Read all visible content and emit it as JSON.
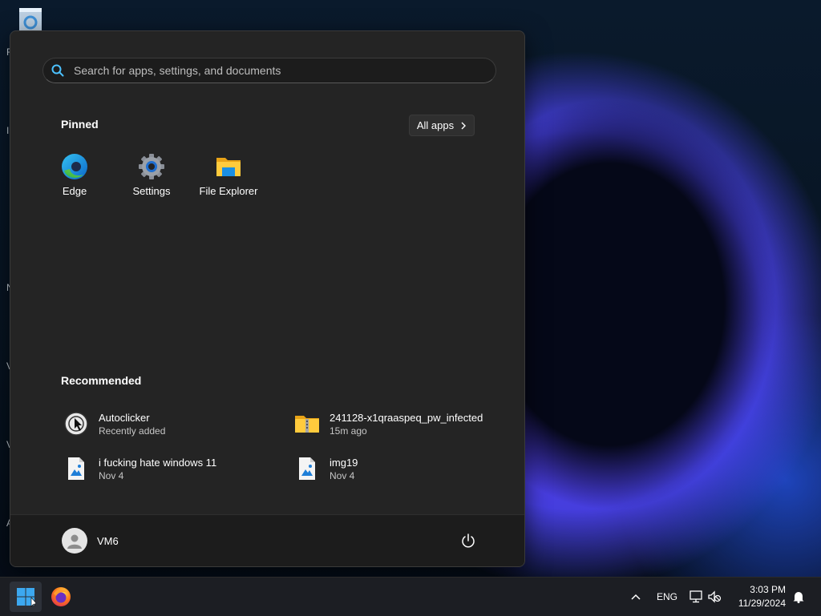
{
  "search": {
    "placeholder": "Search for apps, settings, and documents"
  },
  "pinned": {
    "title": "Pinned",
    "all_apps_label": "All apps",
    "apps": [
      {
        "label": "Edge",
        "icon": "edge-icon"
      },
      {
        "label": "Settings",
        "icon": "settings-gear-icon"
      },
      {
        "label": "File Explorer",
        "icon": "folder-icon"
      }
    ]
  },
  "recommended": {
    "title": "Recommended",
    "items": [
      {
        "title": "Autoclicker",
        "subtitle": "Recently added",
        "icon": "autoclicker-icon"
      },
      {
        "title": "241128-x1qraaspeq_pw_infected",
        "subtitle": "15m ago",
        "icon": "zip-folder-icon"
      },
      {
        "title": "i fucking hate windows 11",
        "subtitle": "Nov 4",
        "icon": "image-file-icon"
      },
      {
        "title": "img19",
        "subtitle": "Nov 4",
        "icon": "image-file-icon"
      }
    ]
  },
  "user": {
    "name": "VM6"
  },
  "desktop": {
    "edge_letters": [
      "R",
      "I",
      "N",
      "V",
      "V",
      "A"
    ]
  },
  "taskbar": {
    "language": "ENG",
    "time": "3:03 PM",
    "date": "11/29/2024"
  },
  "colors": {
    "menu_bg": "#242424",
    "footer_bg": "#1c1c1c",
    "taskbar_bg": "#1c1e23",
    "accent": "#0078d4"
  }
}
